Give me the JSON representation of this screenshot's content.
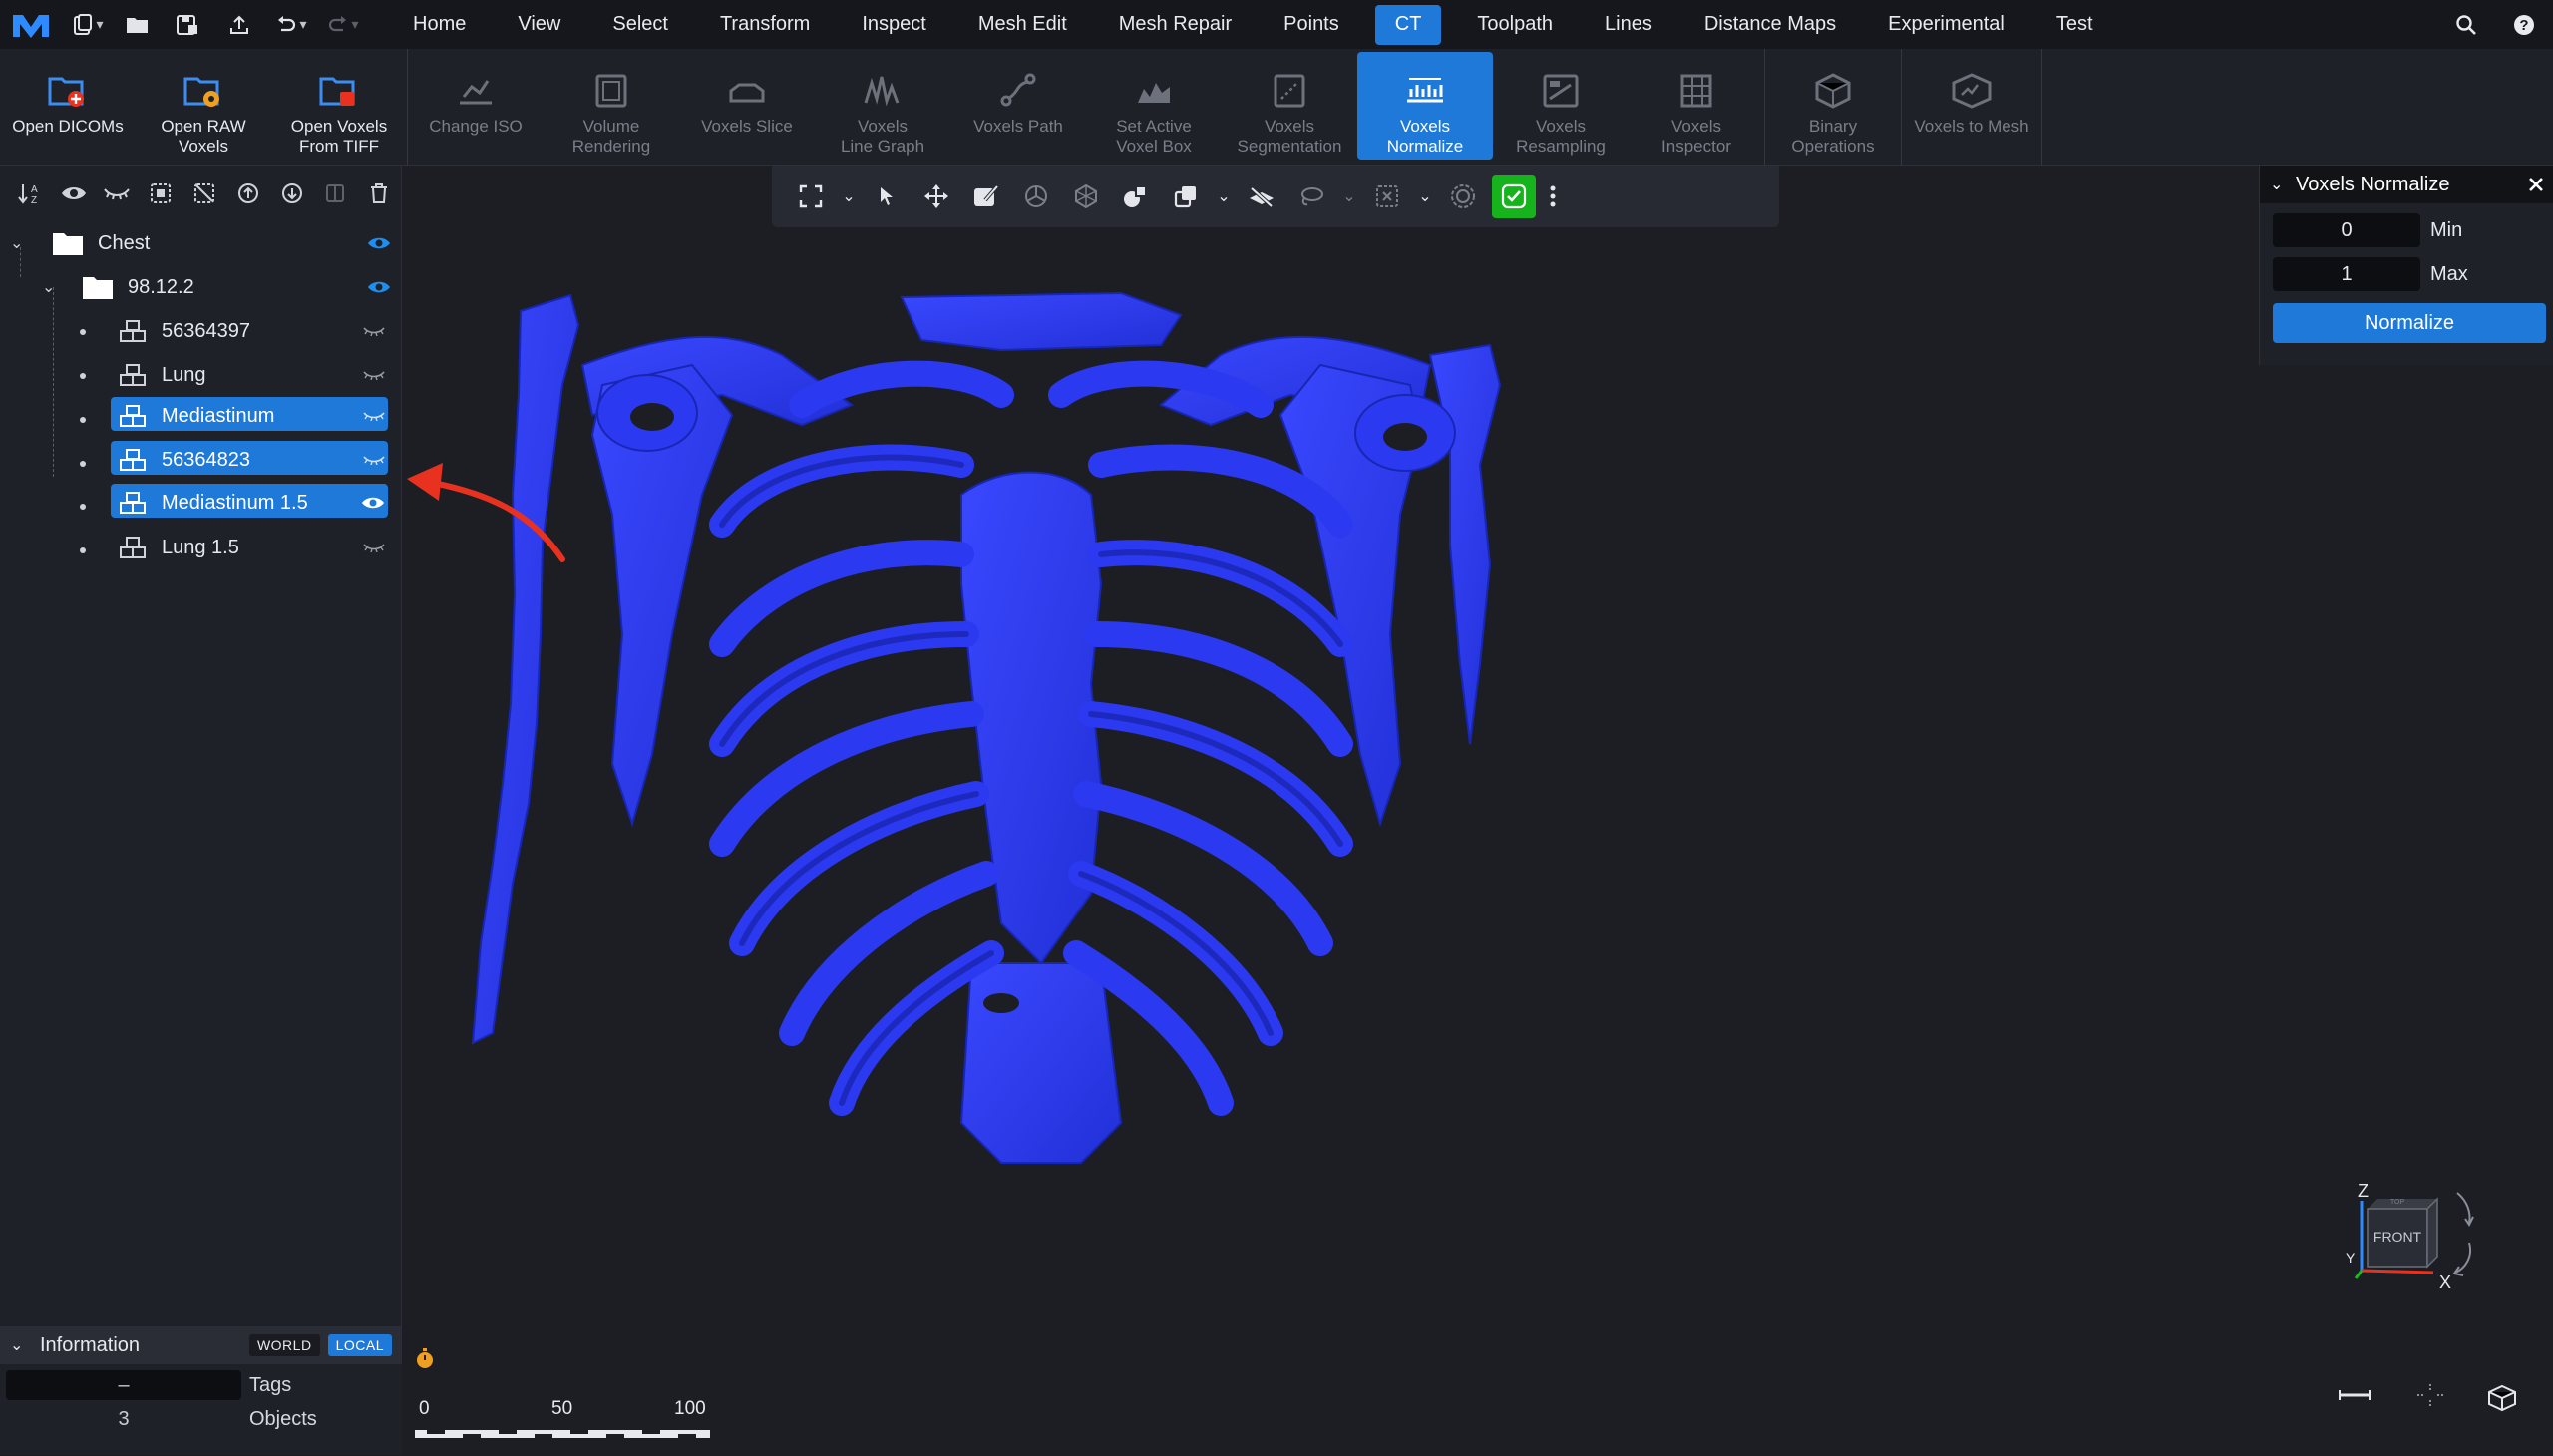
{
  "menubar": {
    "tabs": [
      "Home",
      "View",
      "Select",
      "Transform",
      "Inspect",
      "Mesh Edit",
      "Mesh Repair",
      "Points",
      "CT",
      "Toolpath",
      "Lines",
      "Distance Maps",
      "Experimental",
      "Test"
    ],
    "active_tab": "CT"
  },
  "ribbon": {
    "buttons": [
      {
        "label": "Open DICOMs",
        "icon": "folder-dicom-icon",
        "enabled": true
      },
      {
        "label": "Open RAW\nVoxels",
        "icon": "folder-raw-icon",
        "enabled": true
      },
      {
        "label": "Open Voxels\nFrom TIFF",
        "icon": "folder-tiff-icon",
        "enabled": true
      },
      {
        "label": "Change ISO",
        "icon": "iso-icon",
        "enabled": false
      },
      {
        "label": "Volume\nRendering",
        "icon": "volume-icon",
        "enabled": false
      },
      {
        "label": "Voxels Slice",
        "icon": "slice-icon",
        "enabled": false
      },
      {
        "label": "Voxels\nLine Graph",
        "icon": "line-graph-icon",
        "enabled": false
      },
      {
        "label": "Voxels Path",
        "icon": "path-icon",
        "enabled": false
      },
      {
        "label": "Set Active\nVoxel Box",
        "icon": "voxel-box-icon",
        "enabled": false
      },
      {
        "label": "Voxels\nSegmentation",
        "icon": "segmentation-icon",
        "enabled": false
      },
      {
        "label": "Voxels\nNormalize",
        "icon": "normalize-icon",
        "enabled": true,
        "active": true
      },
      {
        "label": "Voxels\nResampling",
        "icon": "resampling-icon",
        "enabled": false
      },
      {
        "label": "Voxels\nInspector",
        "icon": "inspector-icon",
        "enabled": false
      },
      {
        "label": "Binary\nOperations",
        "icon": "binary-icon",
        "enabled": false
      },
      {
        "label": "Voxels to Mesh",
        "icon": "voxels-to-mesh-icon",
        "enabled": false
      }
    ]
  },
  "tree": {
    "root": "Chest",
    "folder": "98.12.2",
    "items": [
      {
        "label": "56364397",
        "selected": false,
        "visible": false
      },
      {
        "label": "Lung",
        "selected": false,
        "visible": false
      },
      {
        "label": "Mediastinum",
        "selected": true,
        "visible": false
      },
      {
        "label": "56364823",
        "selected": true,
        "visible": false
      },
      {
        "label": "Mediastinum 1.5",
        "selected": true,
        "visible": true
      },
      {
        "label": "Lung 1.5",
        "selected": false,
        "visible": false
      }
    ]
  },
  "info": {
    "title": "Information",
    "world": "WORLD",
    "local": "LOCAL",
    "tags_value": "–",
    "tags_label": "Tags",
    "objects_value": "3",
    "objects_label": "Objects"
  },
  "normalize": {
    "title": "Voxels Normalize",
    "min_value": "0",
    "min_label": "Min",
    "max_value": "1",
    "max_label": "Max",
    "button": "Normalize"
  },
  "scale": {
    "ticks": [
      "0",
      "50",
      "100"
    ]
  },
  "viewcube": {
    "face": "FRONT",
    "top": "TOP",
    "axis_x": "X",
    "axis_y": "Y",
    "axis_z": "Z"
  },
  "colors": {
    "accent": "#1e79d8",
    "volume": "#2b39f0",
    "ok": "#16b31c",
    "arrow": "#e8321f"
  }
}
